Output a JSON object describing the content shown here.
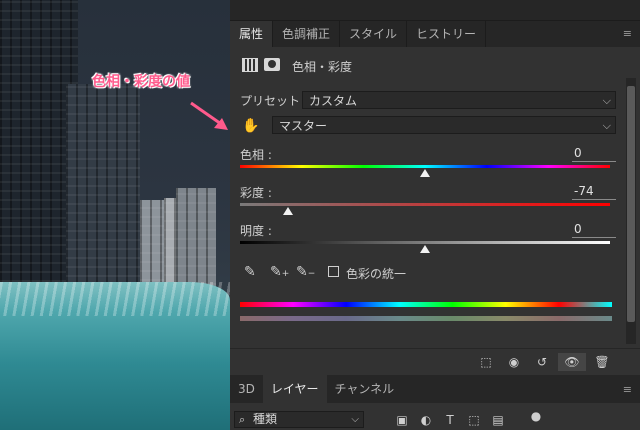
{
  "annotation": {
    "text": "色相・彩度の値",
    "color": "#ff5a8c"
  },
  "panel": {
    "tabs": [
      "属性",
      "色調補正",
      "スタイル",
      "ヒストリー"
    ],
    "active_tab": "属性",
    "adjustment_title": "色相・彩度",
    "preset_label": "プリセット :",
    "preset_value": "カスタム",
    "channel_value": "マスター",
    "hue": {
      "label": "色相 :",
      "value": "0",
      "level": 0.5
    },
    "saturation": {
      "label": "彩度 :",
      "value": "-74",
      "level": 0.13
    },
    "lightness": {
      "label": "明度 :",
      "value": "0",
      "level": 0.5
    },
    "colorize_label": "色彩の統一",
    "colorize_checked": false
  },
  "bottom_tabs": [
    "3D",
    "レイヤー",
    "チャンネル"
  ],
  "active_bottom_tab": "レイヤー",
  "filter": {
    "kind_label": "種類"
  },
  "icons": [
    "hand-target-icon",
    "eyedropper-icon",
    "eyedropper-plus-icon",
    "eyedropper-minus-icon",
    "clip-layer-icon",
    "view-previous-icon",
    "reset-icon",
    "visibility-eye-icon",
    "trash-icon",
    "panel-menu-icon"
  ]
}
